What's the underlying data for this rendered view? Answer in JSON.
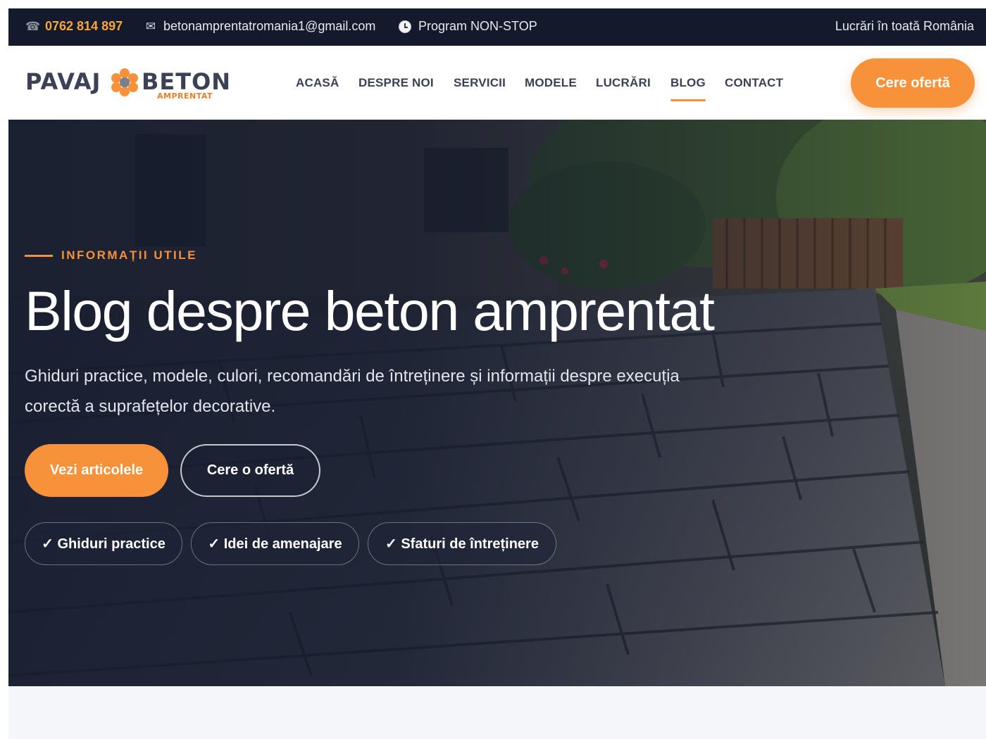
{
  "topbar": {
    "phone": "0762 814 897",
    "email": "betonamprentatromania1@gmail.com",
    "schedule": "Program NON-STOP",
    "coverage": "Lucrări în toată România"
  },
  "brand": {
    "word_left": "PAVAJ",
    "word_right": "BETON",
    "subtitle": "AMPRENTAT",
    "accent_color": "#f7923a",
    "dark_color": "#141a2b"
  },
  "nav": {
    "items": [
      {
        "label": "ACASĂ"
      },
      {
        "label": "DESPRE NOI"
      },
      {
        "label": "SERVICII"
      },
      {
        "label": "MODELE"
      },
      {
        "label": "LUCRĂRI"
      },
      {
        "label": "BLOG"
      },
      {
        "label": "CONTACT"
      }
    ],
    "active": "BLOG",
    "cta": "Cere ofertă"
  },
  "hero": {
    "eyebrow": "INFORMAȚII UTILE",
    "title": "Blog despre beton amprentat",
    "description_line1": "Ghiduri practice, modele, culori, recomandări de întreținere și informații despre execuția",
    "description_line2": "corectă a suprafețelor decorative.",
    "primary_button": "Vezi articolele",
    "secondary_button": "Cere o ofertă",
    "chips": [
      "✓ Ghiduri practice",
      "✓ Idei de amenajare",
      "✓ Sfaturi de întreținere"
    ]
  }
}
